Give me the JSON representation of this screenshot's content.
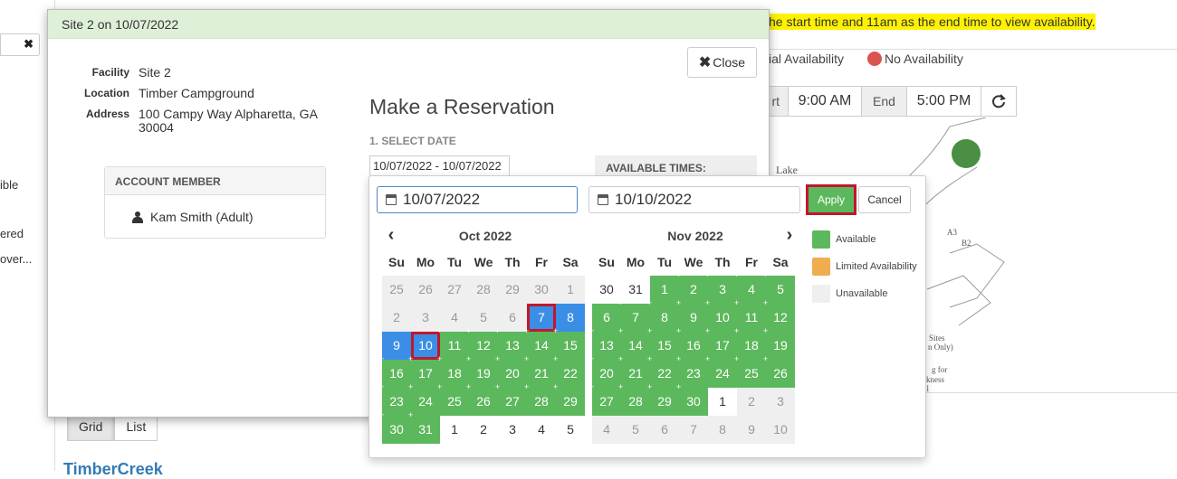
{
  "background": {
    "note": "he start time and 11am as the end time to view availability.",
    "side_texts": [
      "ible",
      "ered",
      "over..."
    ],
    "legend_partial": "ial Availability",
    "legend_none": "No Availability",
    "start_label": "rt",
    "start_value": "9:00 AM",
    "end_label": "End",
    "end_value": "5:00 PM",
    "map_labels": [
      "Lake",
      "A3",
      "B2",
      "Sites",
      "n Only)",
      "g for",
      "kness",
      "il"
    ],
    "view_buttons": [
      "Grid",
      "List"
    ],
    "campground_link": "TimberCreek",
    "colors": {
      "highlight": "#fff200",
      "no_availability": "#d9534f",
      "map_marker": "#4a8f43"
    }
  },
  "modal": {
    "header": "Site 2 on 10/07/2022",
    "close_label": "Close",
    "details": [
      {
        "key": "Facility",
        "value": "Site 2"
      },
      {
        "key": "Location",
        "value": "Timber Campground"
      },
      {
        "key": "Address",
        "value": "100 Campy Way Alpharetta, GA 30004"
      }
    ],
    "account_header": "ACCOUNT MEMBER",
    "account_member": "Kam Smith (Adult)",
    "title": "Make a Reservation",
    "step1": "1. SELECT DATE",
    "date_range_value": "10/07/2022 - 10/07/2022",
    "available_times_label": "AVAILABLE TIMES:"
  },
  "picker": {
    "start_date": "10/07/2022",
    "end_date": "10/10/2022",
    "apply_label": "Apply",
    "cancel_label": "Cancel",
    "days_of_week": [
      "Su",
      "Mo",
      "Tu",
      "We",
      "Th",
      "Fr",
      "Sa"
    ],
    "months": [
      {
        "title": "Oct 2022",
        "weeks": [
          [
            {
              "d": "25",
              "s": "unavail"
            },
            {
              "d": "26",
              "s": "unavail"
            },
            {
              "d": "27",
              "s": "unavail"
            },
            {
              "d": "28",
              "s": "unavail"
            },
            {
              "d": "29",
              "s": "unavail"
            },
            {
              "d": "30",
              "s": "unavail"
            },
            {
              "d": "1",
              "s": "unavail"
            }
          ],
          [
            {
              "d": "2",
              "s": "unavail"
            },
            {
              "d": "3",
              "s": "unavail"
            },
            {
              "d": "4",
              "s": "unavail"
            },
            {
              "d": "5",
              "s": "unavail"
            },
            {
              "d": "6",
              "s": "unavail"
            },
            {
              "d": "7",
              "s": "selected",
              "hl": true
            },
            {
              "d": "8",
              "s": "selected"
            }
          ],
          [
            {
              "d": "9",
              "s": "selected"
            },
            {
              "d": "10",
              "s": "selected",
              "hl": true
            },
            {
              "d": "11",
              "s": "avail"
            },
            {
              "d": "12",
              "s": "avail"
            },
            {
              "d": "13",
              "s": "avail"
            },
            {
              "d": "14",
              "s": "avail"
            },
            {
              "d": "15",
              "s": "avail"
            }
          ],
          [
            {
              "d": "16",
              "s": "avail"
            },
            {
              "d": "17",
              "s": "avail"
            },
            {
              "d": "18",
              "s": "avail"
            },
            {
              "d": "19",
              "s": "avail"
            },
            {
              "d": "20",
              "s": "avail"
            },
            {
              "d": "21",
              "s": "avail"
            },
            {
              "d": "22",
              "s": "avail"
            }
          ],
          [
            {
              "d": "23",
              "s": "avail"
            },
            {
              "d": "24",
              "s": "avail"
            },
            {
              "d": "25",
              "s": "avail"
            },
            {
              "d": "26",
              "s": "avail"
            },
            {
              "d": "27",
              "s": "avail"
            },
            {
              "d": "28",
              "s": "avail"
            },
            {
              "d": "29",
              "s": "avail"
            }
          ],
          [
            {
              "d": "30",
              "s": "avail"
            },
            {
              "d": "31",
              "s": "avail"
            },
            {
              "d": "1",
              "s": "plain"
            },
            {
              "d": "2",
              "s": "plain"
            },
            {
              "d": "3",
              "s": "plain"
            },
            {
              "d": "4",
              "s": "plain"
            },
            {
              "d": "5",
              "s": "plain"
            }
          ]
        ]
      },
      {
        "title": "Nov 2022",
        "weeks": [
          [
            {
              "d": "30",
              "s": "plain"
            },
            {
              "d": "31",
              "s": "plain"
            },
            {
              "d": "1",
              "s": "avail"
            },
            {
              "d": "2",
              "s": "avail"
            },
            {
              "d": "3",
              "s": "avail"
            },
            {
              "d": "4",
              "s": "avail"
            },
            {
              "d": "5",
              "s": "avail"
            }
          ],
          [
            {
              "d": "6",
              "s": "avail"
            },
            {
              "d": "7",
              "s": "avail"
            },
            {
              "d": "8",
              "s": "avail"
            },
            {
              "d": "9",
              "s": "avail"
            },
            {
              "d": "10",
              "s": "avail"
            },
            {
              "d": "11",
              "s": "avail"
            },
            {
              "d": "12",
              "s": "avail"
            }
          ],
          [
            {
              "d": "13",
              "s": "avail"
            },
            {
              "d": "14",
              "s": "avail"
            },
            {
              "d": "15",
              "s": "avail"
            },
            {
              "d": "16",
              "s": "avail"
            },
            {
              "d": "17",
              "s": "avail"
            },
            {
              "d": "18",
              "s": "avail"
            },
            {
              "d": "19",
              "s": "avail"
            }
          ],
          [
            {
              "d": "20",
              "s": "avail"
            },
            {
              "d": "21",
              "s": "avail"
            },
            {
              "d": "22",
              "s": "avail"
            },
            {
              "d": "23",
              "s": "avail"
            },
            {
              "d": "24",
              "s": "avail"
            },
            {
              "d": "25",
              "s": "avail"
            },
            {
              "d": "26",
              "s": "avail"
            }
          ],
          [
            {
              "d": "27",
              "s": "avail"
            },
            {
              "d": "28",
              "s": "avail"
            },
            {
              "d": "29",
              "s": "avail"
            },
            {
              "d": "30",
              "s": "avail"
            },
            {
              "d": "1",
              "s": "plain"
            },
            {
              "d": "2",
              "s": "unavail"
            },
            {
              "d": "3",
              "s": "unavail"
            }
          ],
          [
            {
              "d": "4",
              "s": "unavail"
            },
            {
              "d": "5",
              "s": "unavail"
            },
            {
              "d": "6",
              "s": "unavail"
            },
            {
              "d": "7",
              "s": "unavail"
            },
            {
              "d": "8",
              "s": "unavail"
            },
            {
              "d": "9",
              "s": "unavail"
            },
            {
              "d": "10",
              "s": "unavail"
            }
          ]
        ]
      }
    ],
    "legend": [
      {
        "label": "Available",
        "color": "#5cb85c"
      },
      {
        "label": "Limited Availability",
        "color": "#f0ad4e"
      },
      {
        "label": "Unavailable",
        "color": "#efefef"
      }
    ]
  }
}
